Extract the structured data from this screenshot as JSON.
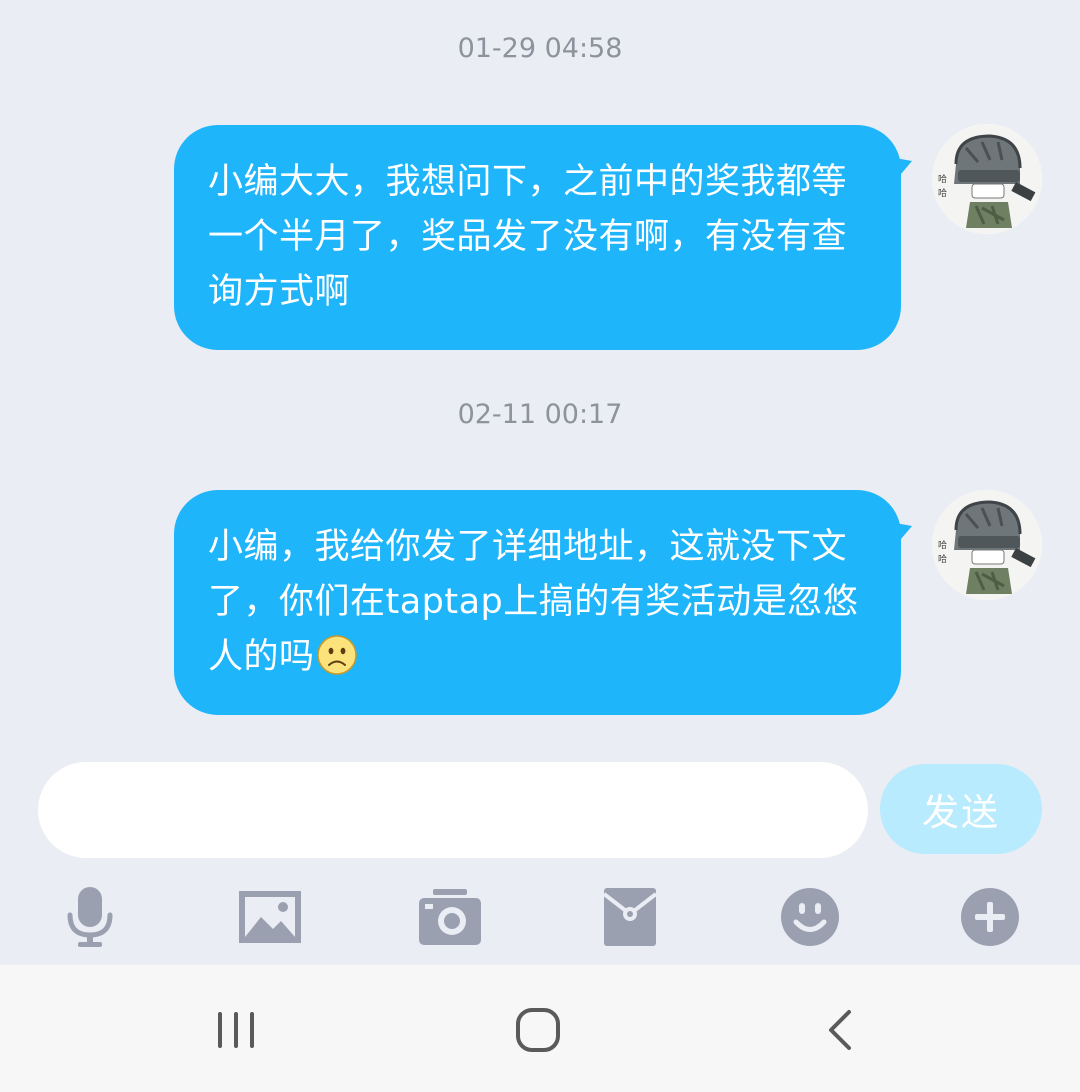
{
  "conversation": {
    "messages": [
      {
        "timestamp": "01-29 04:58",
        "text": "小编大大，我想问下，之前中的奖我都等一个半月了，奖品发了没有啊，有没有查询方式啊",
        "emoji": ""
      },
      {
        "timestamp": "02-11 00:17",
        "text": "小编，我给你发了详细地址，这就没下文了，你们在taptap上搞的有奖活动是忽悠人的吗",
        "emoji": "frown-face"
      }
    ]
  },
  "composer": {
    "input_value": "",
    "send_label": "发送"
  },
  "toolbar": {
    "items": [
      "microphone-icon",
      "image-icon",
      "camera-icon",
      "red-packet-icon",
      "emoji-icon",
      "plus-icon"
    ]
  },
  "navigation": {
    "items": [
      "recent-apps-icon",
      "home-icon",
      "back-icon"
    ]
  },
  "colors": {
    "background": "#eaedf4",
    "bubble": "#1fb5fb",
    "send_button": "#b7ebfd",
    "timestamp": "#8d929c",
    "icon": "#9aa0af"
  }
}
